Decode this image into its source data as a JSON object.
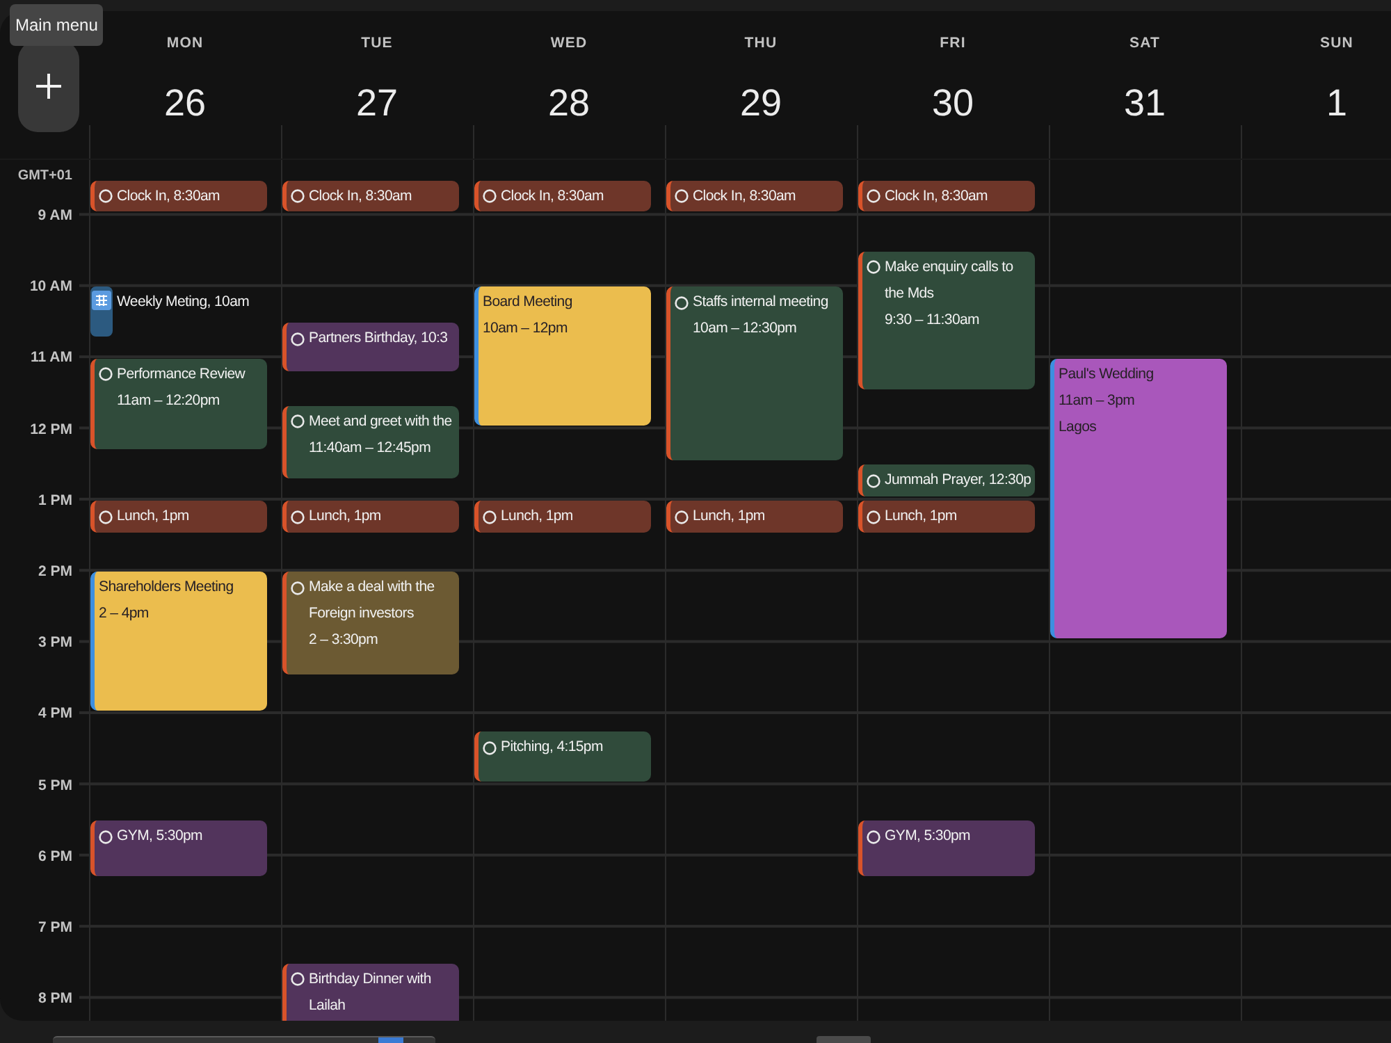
{
  "add_button": {
    "tooltip": "Main menu"
  },
  "timezone": "GMT+01",
  "hours": [
    "9 AM",
    "10 AM",
    "11 AM",
    "12 PM",
    "1 PM",
    "2 PM",
    "3 PM",
    "4 PM",
    "5 PM",
    "6 PM",
    "7 PM",
    "8 PM"
  ],
  "days": [
    {
      "name": "MON",
      "date": "26",
      "events": [
        {
          "kind": "task",
          "title": "Clock In, 8:30am",
          "color": "#6e3629"
        },
        {
          "kind": "meeting",
          "title": "Weekly Meting, 10am",
          "color": "#2c5a80"
        },
        {
          "kind": "task",
          "title": "Performance Review",
          "time": "11am – 12:20pm",
          "color": "#304b3b"
        },
        {
          "kind": "task",
          "title": "Lunch, 1pm",
          "color": "#6e3629"
        },
        {
          "kind": "event",
          "title": "Shareholders Meeting",
          "time": "2 – 4pm",
          "color": "#ebbd4e"
        },
        {
          "kind": "task",
          "title": "GYM, 5:30pm",
          "color": "#52345c"
        }
      ]
    },
    {
      "name": "TUE",
      "date": "27",
      "events": [
        {
          "kind": "task",
          "title": "Clock In, 8:30am",
          "color": "#6e3629"
        },
        {
          "kind": "task",
          "title": "Partners Birthday, 10:3",
          "color": "#52345c"
        },
        {
          "kind": "task",
          "title": "Meet and greet with the",
          "time": "11:40am – 12:45pm",
          "color": "#304b3b"
        },
        {
          "kind": "task",
          "title": "Lunch, 1pm",
          "color": "#6e3629"
        },
        {
          "kind": "task",
          "title": "Make a deal with the Foreign investors",
          "time": "2 – 3:30pm",
          "color": "#6c5a33"
        },
        {
          "kind": "task",
          "title": "Birthday Dinner with Lailah",
          "color": "#52345c"
        }
      ]
    },
    {
      "name": "WED",
      "date": "28",
      "events": [
        {
          "kind": "task",
          "title": "Clock In, 8:30am",
          "color": "#6e3629"
        },
        {
          "kind": "event",
          "title": "Board Meeting",
          "time": "10am – 12pm",
          "color": "#ebbd4e"
        },
        {
          "kind": "task",
          "title": "Lunch, 1pm",
          "color": "#6e3629"
        },
        {
          "kind": "task",
          "title": "Pitching, 4:15pm",
          "color": "#304b3b"
        }
      ]
    },
    {
      "name": "THU",
      "date": "29",
      "events": [
        {
          "kind": "task",
          "title": "Clock In, 8:30am",
          "color": "#6e3629"
        },
        {
          "kind": "task",
          "title": "Staffs internal meeting",
          "time": "10am – 12:30pm",
          "color": "#304b3b"
        },
        {
          "kind": "task",
          "title": "Lunch, 1pm",
          "color": "#6e3629"
        }
      ]
    },
    {
      "name": "FRI",
      "date": "30",
      "events": [
        {
          "kind": "task",
          "title": "Clock In, 8:30am",
          "color": "#6e3629"
        },
        {
          "kind": "task",
          "title": "Make enquiry calls to the Mds",
          "time": "9:30 – 11:30am",
          "color": "#304b3b"
        },
        {
          "kind": "task",
          "title": "Jummah Prayer, 12:30p",
          "color": "#304b3b"
        },
        {
          "kind": "task",
          "title": "Lunch, 1pm",
          "color": "#6e3629"
        },
        {
          "kind": "task",
          "title": "GYM, 5:30pm",
          "color": "#52345c"
        }
      ]
    },
    {
      "name": "SAT",
      "date": "31",
      "events": [
        {
          "kind": "event",
          "title": "Paul's Wedding",
          "time": "11am – 3pm",
          "location": "Lagos",
          "color": "#a957bb"
        }
      ]
    },
    {
      "name": "SUN",
      "date": "1"
    }
  ]
}
